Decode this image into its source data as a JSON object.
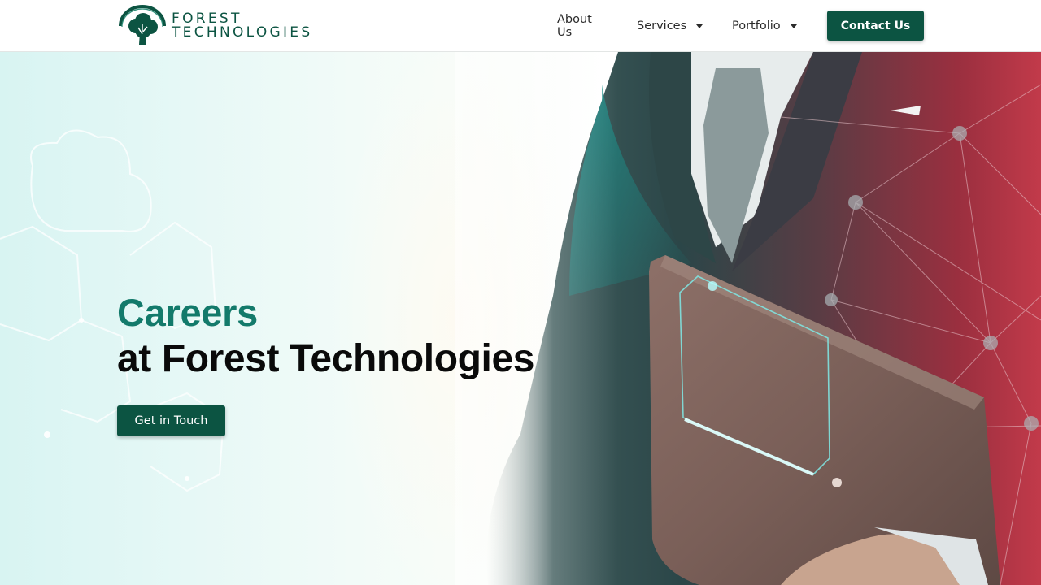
{
  "header": {
    "logo": {
      "line1": "FOREST",
      "line2": "TECHNOLOGIES",
      "icon": "tree-logo-icon"
    },
    "nav": [
      {
        "label": "About Us",
        "has_dropdown": false
      },
      {
        "label": "Services",
        "has_dropdown": true
      },
      {
        "label": "Portfolio",
        "has_dropdown": true
      }
    ],
    "contact_label": "Contact Us"
  },
  "hero": {
    "title_accent": "Careers",
    "title_main": "at Forest Technologies",
    "cta_label": "Get in Touch"
  },
  "colors": {
    "brand_green": "#0c5442",
    "accent_teal": "#137a6b",
    "hero_tint": "#d8f4f2",
    "network_red": "#c23a4a"
  }
}
